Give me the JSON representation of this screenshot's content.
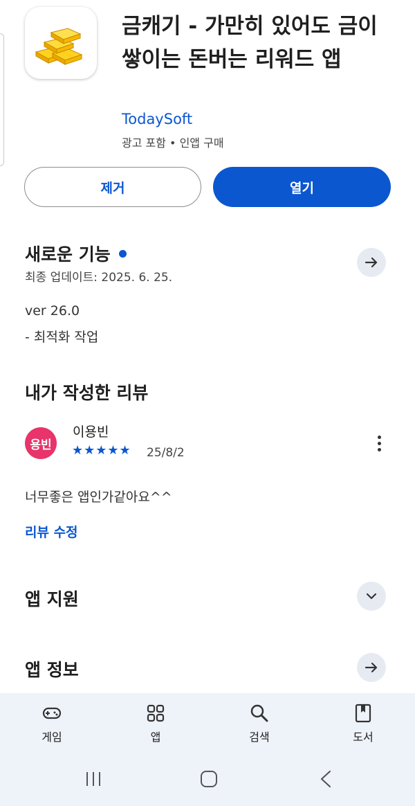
{
  "app": {
    "title": "금캐기 - 가만히 있어도 금이 쌓이는 돈버는 리워드 앱",
    "developer": "TodaySoft",
    "meta": "광고 포함 • 인앱 구매",
    "icon": "gold-bars-icon"
  },
  "actions": {
    "remove_label": "제거",
    "open_label": "열기"
  },
  "whats_new": {
    "title": "새로운 기능",
    "last_updated": "최종 업데이트: 2025. 6. 25.",
    "version": "ver 26.0",
    "notes": "- 최적화 작업"
  },
  "my_review": {
    "section_title": "내가 작성한 리뷰",
    "avatar_text": "용빈",
    "reviewer_name": "이용빈",
    "rating": 5,
    "stars_text": "★★★★★",
    "date": "25/8/2",
    "body": "너무좋은 앱인가같아요^^",
    "edit_label": "리뷰 수정"
  },
  "sections": {
    "app_support": "앱 지원",
    "app_info": "앱 정보"
  },
  "bottom_nav": {
    "games": "게임",
    "apps": "앱",
    "search": "검색",
    "books": "도서"
  },
  "colors": {
    "accent": "#0b57d0",
    "avatar_bg": "#e8336b",
    "nav_bg": "#eef2f9",
    "round_button_bg": "#e6ebf2"
  }
}
